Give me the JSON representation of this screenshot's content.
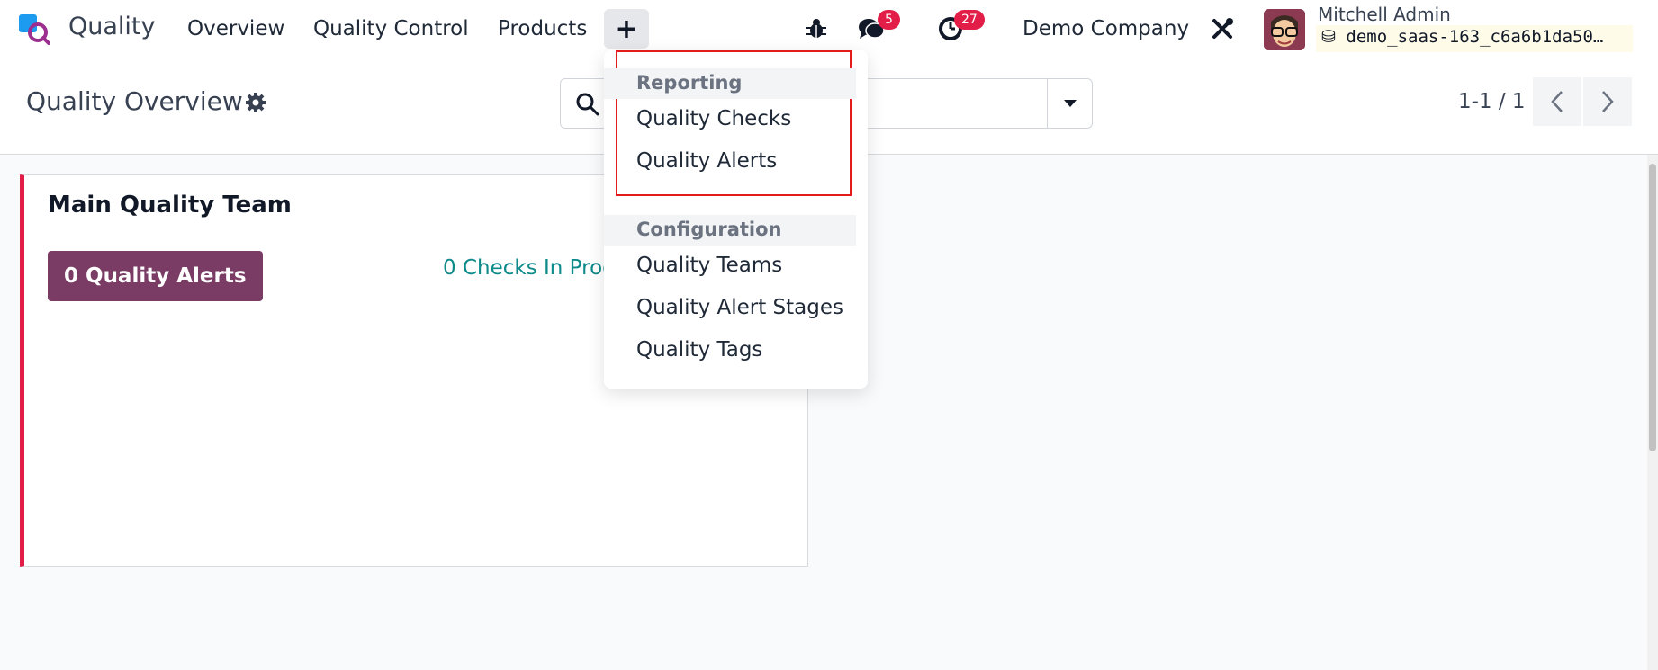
{
  "navbar": {
    "app_name": "Quality",
    "menu": [
      "Overview",
      "Quality Control",
      "Products"
    ],
    "plus_label": "+",
    "messages_count": "5",
    "activities_count": "27",
    "company": "Demo Company",
    "user_name": "Mitchell Admin",
    "database": "demo_saas-163_c6a6b1da50…"
  },
  "control_panel": {
    "title": "Quality Overview",
    "search_placeholder": "",
    "pager": "1-1 / 1"
  },
  "card": {
    "title": "Main Quality Team",
    "alerts_button": "0 Quality Alerts",
    "checks_link": "0 Checks In Prog"
  },
  "dropdown": {
    "reporting_header": "Reporting",
    "reporting_items": [
      "Quality Checks",
      "Quality Alerts"
    ],
    "configuration_header": "Configuration",
    "configuration_items": [
      "Quality Teams",
      "Quality Alert Stages",
      "Quality Tags"
    ]
  },
  "colors": {
    "brand": "#7a3c64",
    "badge": "#e11d48",
    "highlight": "#e21b1b",
    "link": "#0e8a8a"
  },
  "icons": [
    "quality-app-logo-icon",
    "bug-icon",
    "chat-icon",
    "clock-icon",
    "tools-icon",
    "gear-icon",
    "search-icon",
    "caret-down-icon",
    "chevron-left-icon",
    "chevron-right-icon",
    "database-icon"
  ]
}
